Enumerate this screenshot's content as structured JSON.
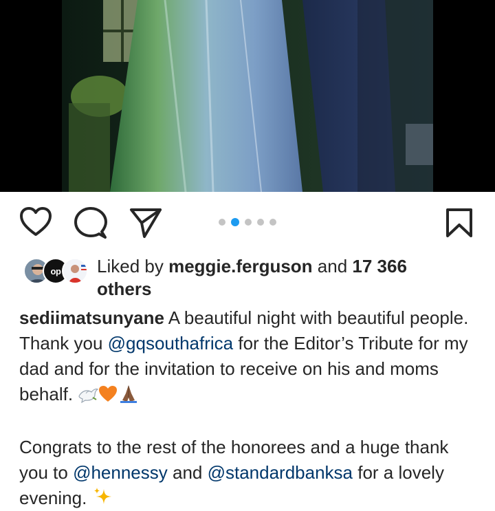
{
  "post": {
    "carousel": {
      "total": 5,
      "active_index": 1
    },
    "icons": {
      "like": "heart-outline-icon",
      "comment": "comment-bubble-icon",
      "share": "paper-plane-icon",
      "save": "bookmark-icon"
    },
    "likes": {
      "prefix": "Liked by ",
      "user": "meggie.ferguson",
      "middle": " and ",
      "count": "17 366",
      "suffix": "others",
      "avatar2_text": "op"
    },
    "caption": {
      "username": "sediimatsunyane",
      "text1": " A beautiful night with beautiful people. Thank you ",
      "mention1": "@gqsouthafrica",
      "text2": " for the Editor’s Tribute for my dad and for the invitation to receive on his and moms behalf. ",
      "para2_text1": "Congrats to the rest of the honorees and a huge thank you to ",
      "mention2": "@hennessy",
      "para2_text2": " and ",
      "mention3": "@standardbanksa",
      "para2_text3": " for a lovely evening. "
    }
  }
}
